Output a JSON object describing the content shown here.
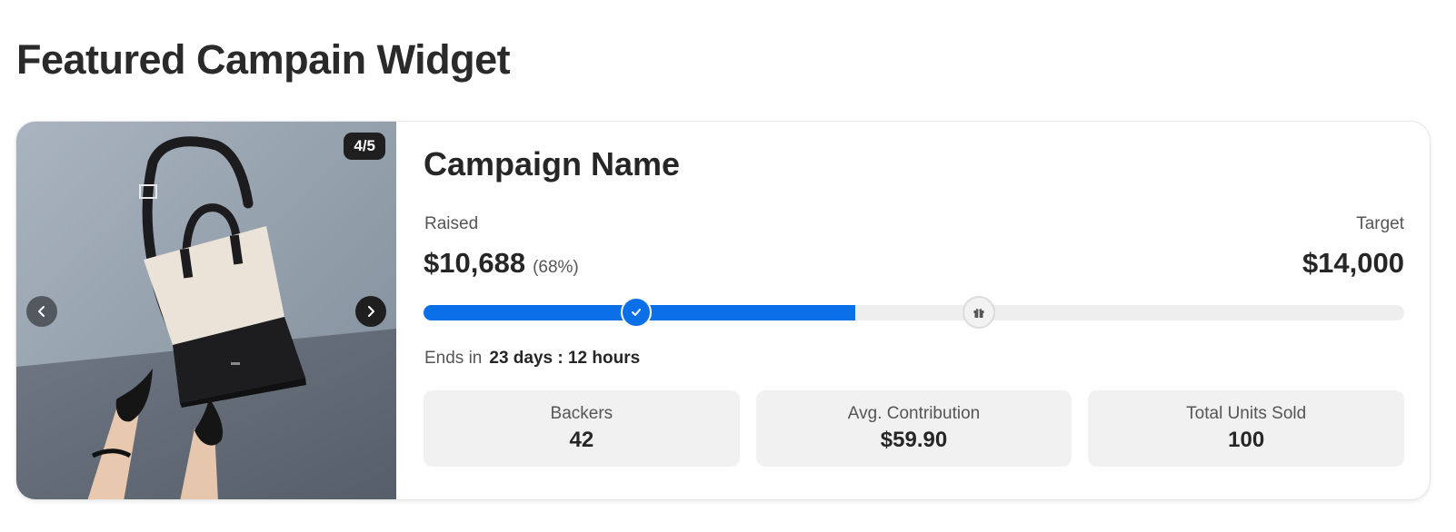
{
  "page": {
    "title": "Featured Campain Widget"
  },
  "gallery": {
    "counter": "4/5",
    "current": 4,
    "total": 5
  },
  "campaign": {
    "name": "Campaign Name",
    "raised_label": "Raised",
    "raised_amount": "$10,688",
    "raised_percent": "(68%)",
    "target_label": "Target",
    "target_amount": "$14,000",
    "ends_label": "Ends in",
    "ends_value": "23 days : 12 hours"
  },
  "progress": {
    "fill_fraction": 0.44,
    "milestones": [
      {
        "icon": "check-icon",
        "fraction": 0.217,
        "reached": true
      },
      {
        "icon": "gift-icon",
        "fraction": 0.566,
        "reached": false
      }
    ]
  },
  "stats": [
    {
      "label": "Backers",
      "value": "42"
    },
    {
      "label": "Avg. Contribution",
      "value": "$59.90"
    },
    {
      "label": "Total Units Sold",
      "value": "100"
    }
  ],
  "colors": {
    "accent": "#0b6fe8",
    "track": "#eeeeee",
    "stat_bg": "#f1f1f1"
  }
}
